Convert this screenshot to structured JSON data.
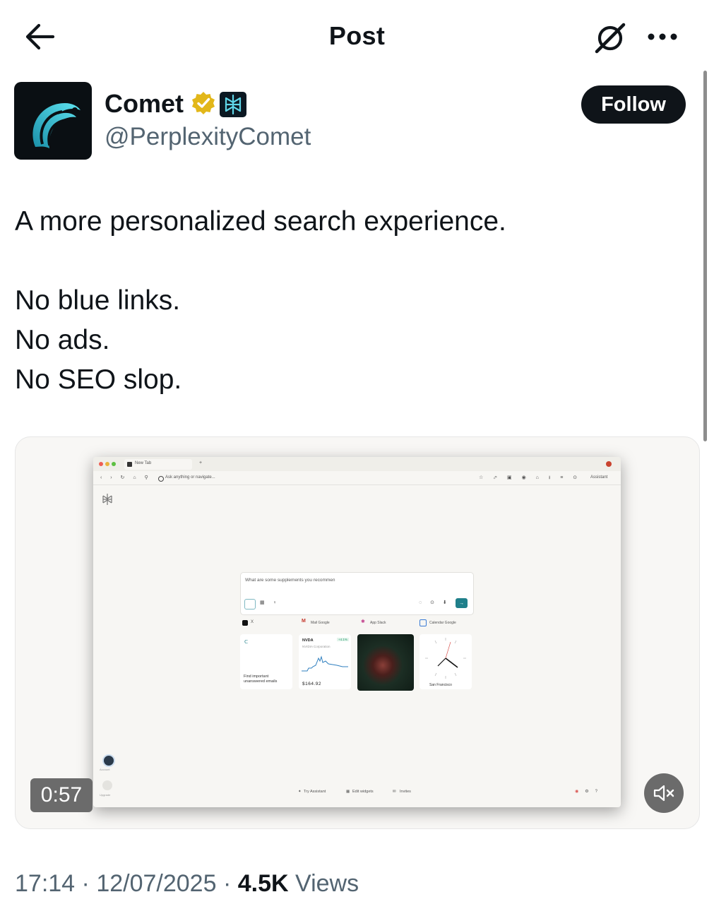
{
  "header": {
    "title": "Post"
  },
  "author": {
    "name": "Comet",
    "handle": "@PerplexityComet",
    "follow_label": "Follow"
  },
  "post": {
    "lines": [
      "A more personalized search experience.",
      "No blue links.",
      "No ads.",
      "No SEO slop."
    ]
  },
  "media": {
    "duration": "0:57",
    "screenshot": {
      "tab_title": "New Tab",
      "address_placeholder": "Ask anything or navigate...",
      "assistant_label": "Assistant",
      "search_query": "What are some supplements you recommen",
      "shortcuts": [
        "X",
        "Mail Google",
        "App Slack",
        "Calendar Google"
      ],
      "widget_email": "Find important unanswered emails",
      "stock_symbol": "NVDA",
      "stock_name": "NVIDIA Corporation",
      "stock_change": "+4.1%",
      "stock_price": "$164.92",
      "clock_city": "San Francisco",
      "sidebar_account": "Account",
      "sidebar_upgrade": "Upgrade",
      "bottom_try": "Try Assistant",
      "bottom_edit": "Edit widgets",
      "bottom_invites": "Invites"
    }
  },
  "footer": {
    "time": "17:14",
    "date": "12/07/2025",
    "views_count": "4.5K",
    "views_label": "Views"
  }
}
